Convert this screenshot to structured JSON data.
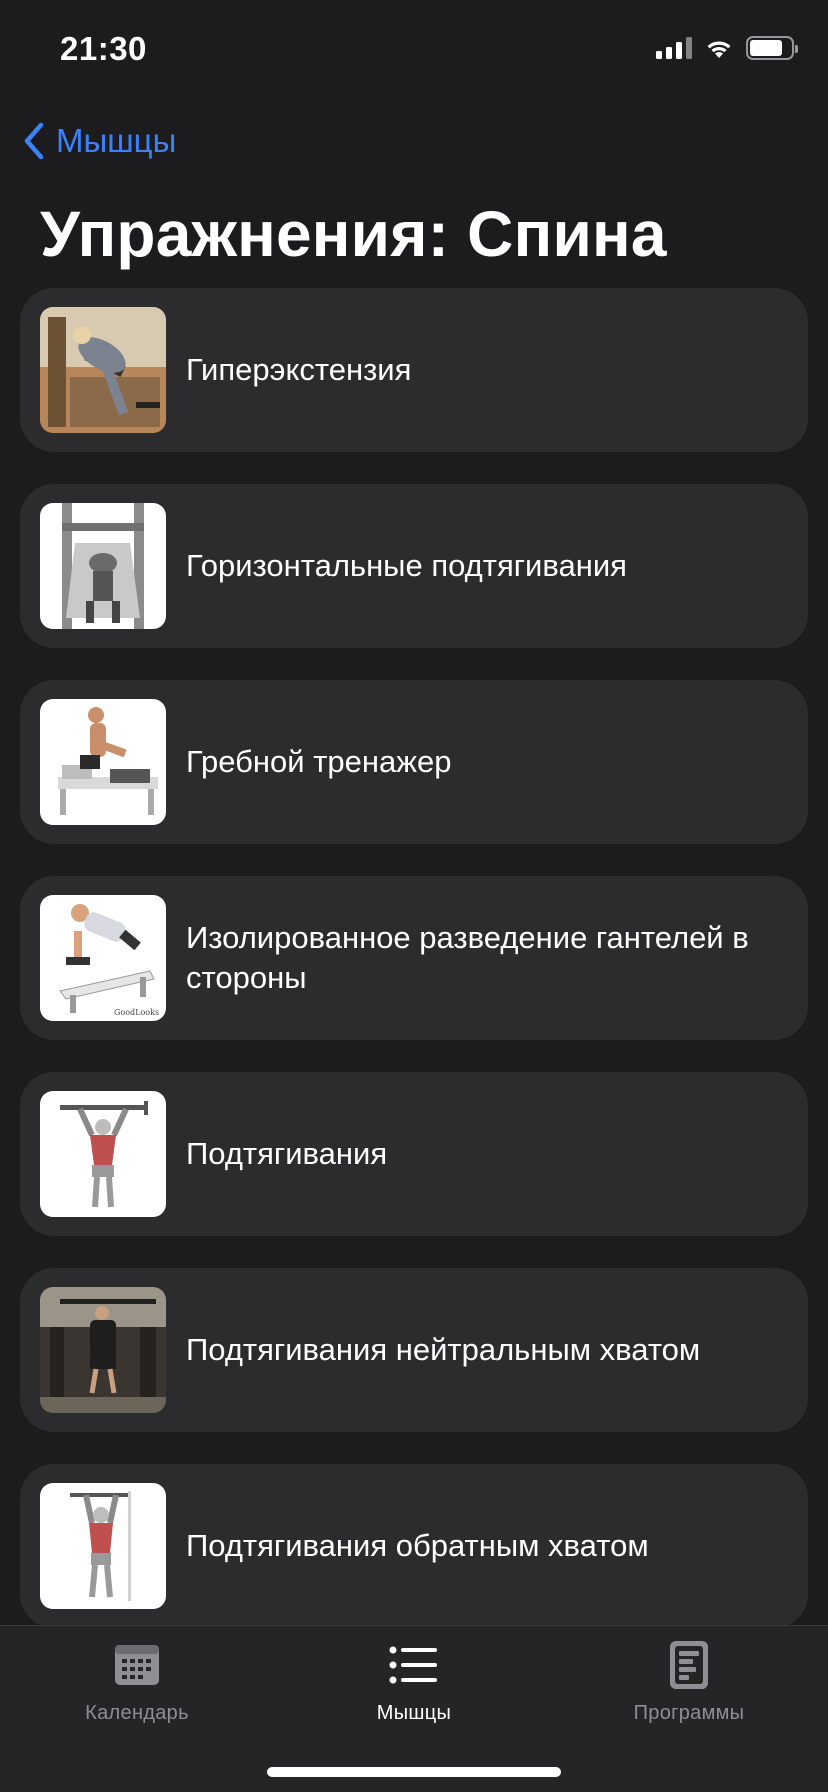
{
  "status_bar": {
    "time": "21:30",
    "battery_level": 0.8
  },
  "nav": {
    "back_label": "Мышцы",
    "title": "Упражнения: Спина"
  },
  "exercises": [
    {
      "name": "Гиперэкстензия",
      "thumb": "hyperextension-photo"
    },
    {
      "name": "Горизонтальные подтягивания",
      "thumb": "horizontal-pullup-machine-photo"
    },
    {
      "name": "Гребной тренажер",
      "thumb": "rowing-machine-photo"
    },
    {
      "name": "Изолированное разведение гантелей в стороны",
      "thumb": "dumbbell-reverse-fly-photo"
    },
    {
      "name": "Подтягивания",
      "thumb": "pullup-illustration"
    },
    {
      "name": "Подтягивания нейтральным хватом",
      "thumb": "neutral-grip-pullup-photo"
    },
    {
      "name": "Подтягивания обратным хватом",
      "thumb": "chinup-illustration"
    }
  ],
  "tab_bar": {
    "tabs": [
      {
        "label": "Календарь",
        "icon": "calendar-icon",
        "active": false
      },
      {
        "label": "Мышцы",
        "icon": "list-icon",
        "active": true
      },
      {
        "label": "Программы",
        "icon": "program-document-icon",
        "active": false
      }
    ]
  },
  "colors": {
    "background": "#1c1c1e",
    "card": "#2c2c2e",
    "accent": "#3a82f7",
    "inactive_tab": "#8e8e93"
  }
}
